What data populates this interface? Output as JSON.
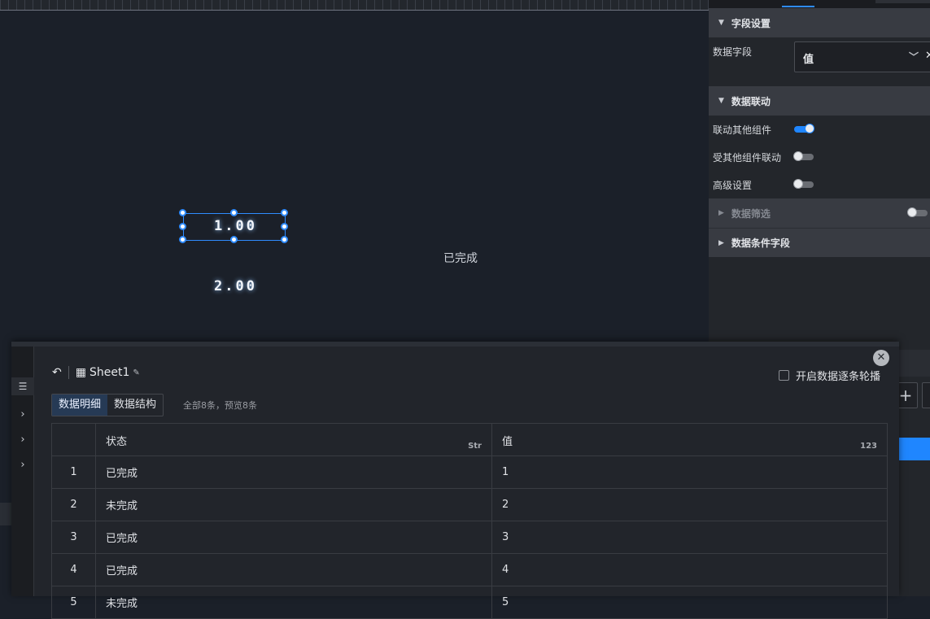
{
  "canvas": {
    "value_a": "1.00",
    "value_b": "2.00",
    "status_text": "已完成"
  },
  "panel": {
    "field_section": {
      "title": "字段设置"
    },
    "data_field": {
      "label": "数据字段",
      "selected": "值",
      "chevron": "chevron-down-icon",
      "clear": "close-icon"
    },
    "linkage_section": {
      "title": "数据联动"
    },
    "link_other": {
      "label": "联动其他组件",
      "on": true
    },
    "linked_by_other": {
      "label": "受其他组件联动",
      "on": false
    },
    "advanced": {
      "label": "高级设置",
      "on": false
    },
    "filter_section": {
      "title": "数据筛选",
      "on": false
    },
    "condition_section": {
      "title": "数据条件字段"
    }
  },
  "dialog": {
    "sheet_name": "Sheet1",
    "carousel_label": "开启数据逐条轮播",
    "tabs": [
      "数据明细",
      "数据结构"
    ],
    "summary": "全部8条，预览8条",
    "columns": [
      {
        "title": "状态",
        "type": "Str"
      },
      {
        "title": "值",
        "type": "123"
      }
    ],
    "rows": [
      {
        "idx": "1",
        "state": "已完成",
        "value": "1"
      },
      {
        "idx": "2",
        "state": "未完成",
        "value": "2"
      },
      {
        "idx": "3",
        "state": "已完成",
        "value": "3"
      },
      {
        "idx": "4",
        "state": "已完成",
        "value": "4"
      },
      {
        "idx": "5",
        "state": "未完成",
        "value": "5"
      }
    ]
  },
  "colors": {
    "accent": "#1f86ff",
    "canvas_bg": "#1b2029",
    "panel_bg": "#23262b"
  }
}
